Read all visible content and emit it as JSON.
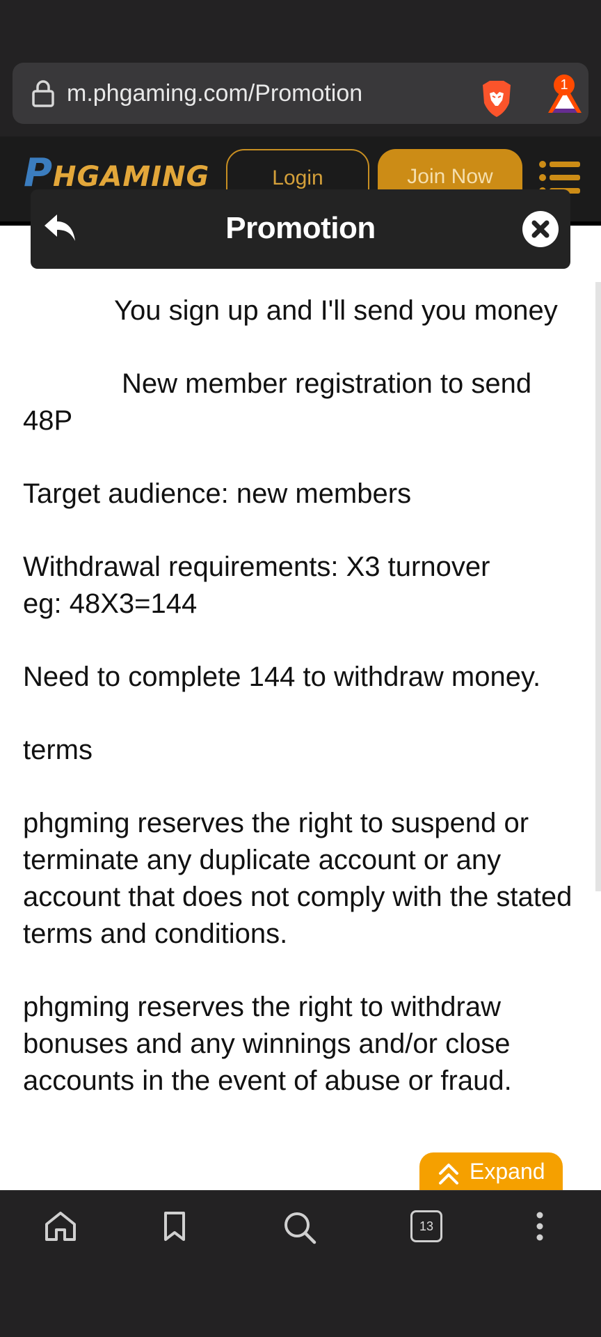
{
  "browser": {
    "url": "m.phgaming.com/Promotion",
    "notification_count": "1",
    "tab_count": "13"
  },
  "site_header": {
    "logo_p": "P",
    "logo_rest": "HGAMING",
    "login_label": "Login",
    "join_label": "Join Now"
  },
  "modal": {
    "title": "Promotion"
  },
  "content": {
    "line1": "You sign up and I'll send you money",
    "line2": "New member registration to send 48P",
    "line3": "Target audience:  new members",
    "line4a": "Withdrawal requirements: X3 turnover",
    "line4b": "eg: 48X3=144",
    "line5": "Need to complete 144 to withdraw money.",
    "line6": "terms",
    "line7": "phgming reserves the right to suspend or terminate any duplicate account or any account that does not comply with the stated terms and conditions.",
    "line8": "phgming reserves the right to withdraw bonuses and any winnings and/or close accounts in the event of abuse or fraud."
  },
  "expand_label": "Expand",
  "colors": {
    "accent": "#cc8c16",
    "expand": "#f5a000",
    "dark_bg": "#232223"
  }
}
